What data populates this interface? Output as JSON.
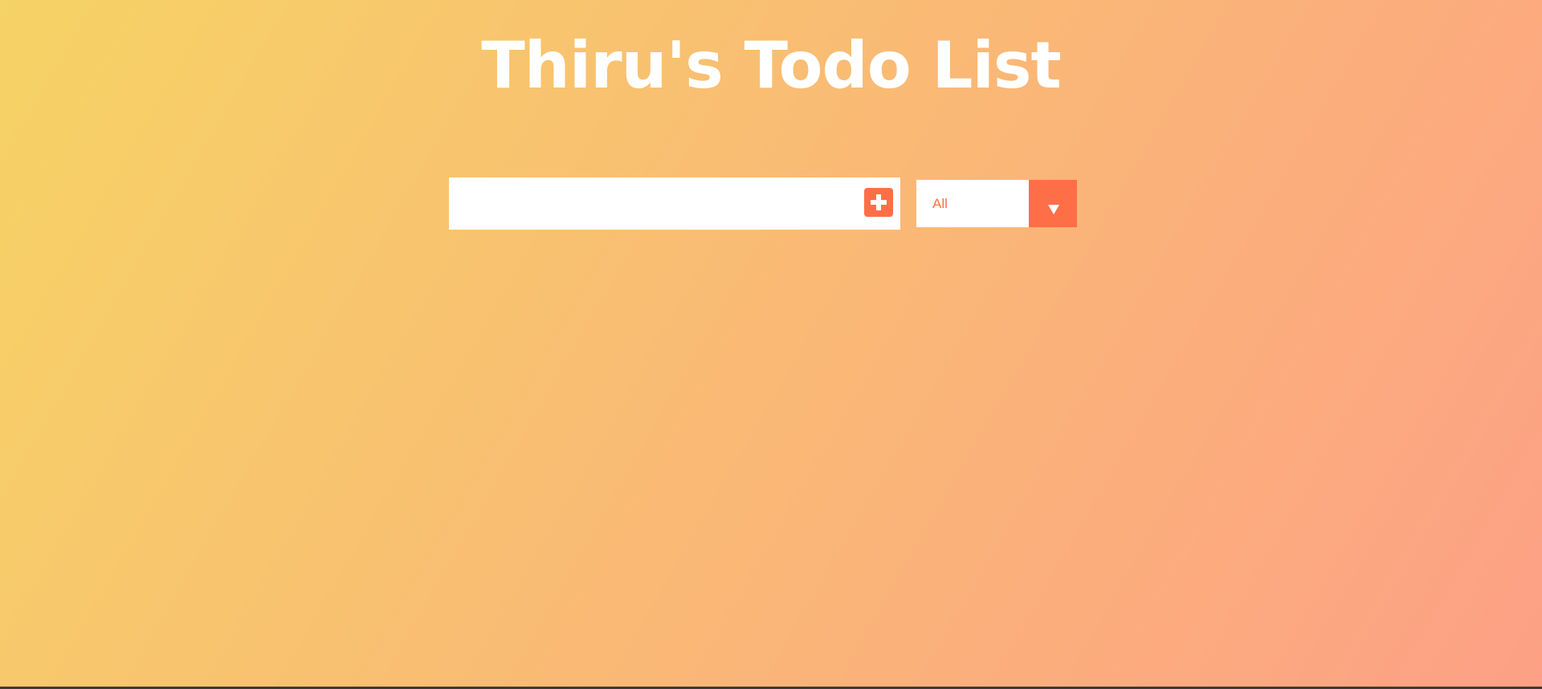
{
  "header": {
    "title": "Thiru's Todo List"
  },
  "form": {
    "input_value": "",
    "add_icon": "plus-square-icon",
    "filter": {
      "selected": "All",
      "icon": "chevron-down-icon"
    }
  },
  "colors": {
    "gradient_start": "#f6d365",
    "gradient_end": "#fda085",
    "accent": "#ff6f47",
    "title_text": "#ffffff"
  }
}
